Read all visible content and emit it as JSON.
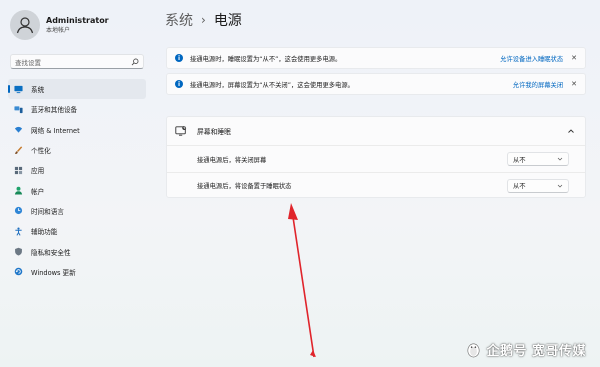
{
  "profile": {
    "name": "Administrator",
    "subtitle": "本地帐户"
  },
  "search": {
    "placeholder": "查找设置"
  },
  "nav": {
    "items": [
      {
        "label": "系统",
        "icon": "monitor-icon",
        "active": true
      },
      {
        "label": "蓝牙和其他设备",
        "icon": "bluetooth-icon"
      },
      {
        "label": "网络 & Internet",
        "icon": "wifi-icon"
      },
      {
        "label": "个性化",
        "icon": "brush-icon"
      },
      {
        "label": "应用",
        "icon": "apps-icon"
      },
      {
        "label": "帐户",
        "icon": "person-icon"
      },
      {
        "label": "时间和语言",
        "icon": "globe-clock-icon"
      },
      {
        "label": "辅助功能",
        "icon": "accessibility-icon"
      },
      {
        "label": "隐私和安全性",
        "icon": "shield-icon"
      },
      {
        "label": "Windows 更新",
        "icon": "update-icon"
      }
    ]
  },
  "breadcrumb": {
    "parent": "系统",
    "separator": "›",
    "current": "电源"
  },
  "info_bars": [
    {
      "text": "接通电源时，睡眠设置为“从不”，这会使用更多电源。",
      "link": "允许设备进入睡眠状态",
      "close": "✕"
    },
    {
      "text": "接通电源时，屏幕设置为“从不关闭”，这会使用更多电源。",
      "link": "允许我的屏幕关闭",
      "close": "✕"
    }
  ],
  "section": {
    "title": "屏幕和睡眠",
    "rows": [
      {
        "label": "接通电源后，将关闭屏幕",
        "value": "从不"
      },
      {
        "label": "接通电源后，将设备置于睡眠状态",
        "value": "从不"
      }
    ]
  },
  "watermark": {
    "text": "企鹅号 宽哥传媒"
  },
  "colors": {
    "accent": "#0067c0",
    "arrow": "#e0242b",
    "background": "#f1f4f9"
  }
}
